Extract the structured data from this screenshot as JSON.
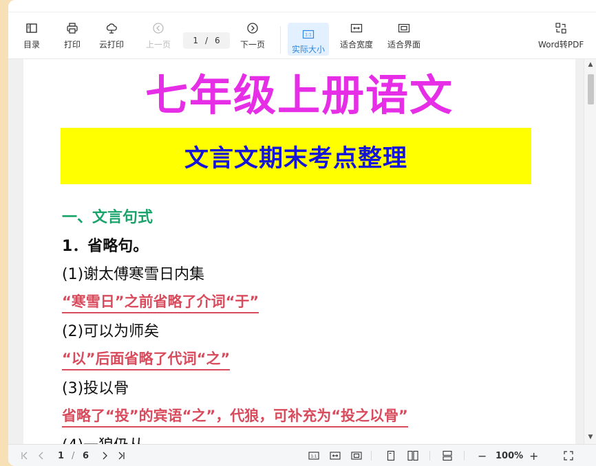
{
  "toolbar": {
    "toc": "目录",
    "print": "打印",
    "cloud_print": "云打印",
    "prev_page": "上一页",
    "current_page": "1",
    "page_sep": "/",
    "total_pages": "6",
    "next_page": "下一页",
    "actual_size": "实际大小",
    "fit_width": "适合宽度",
    "fit_page": "适合界面",
    "word_to_pdf": "Word转PDF",
    "actual_size_icon_text": "1:1"
  },
  "document": {
    "title": "七年级上册语文",
    "banner": "文言文期末考点整理",
    "section1": "一、文言句式",
    "sub1": "1．省略句。",
    "items": [
      {
        "q": "(1)谢太傅寒雪日内集",
        "a": "“寒雪日”之前省略了介词“于”"
      },
      {
        "q": "(2)可以为师矣",
        "a": "“以”后面省略了代词“之”"
      },
      {
        "q": "(3)投以骨",
        "a": "省略了“投”的宾语“之”，代狼，可补充为“投之以骨”"
      }
    ],
    "next_item_partial": "(4)一狼仍从"
  },
  "statusbar": {
    "current_page": "1",
    "page_sep": "/",
    "total_pages": "6",
    "zoom": "100%",
    "zoom_out": "−",
    "zoom_in": "+",
    "actual_size_icon_text": "1:1"
  },
  "colors": {
    "title": "#e62ee6",
    "banner_bg": "#ffff00",
    "banner_text": "#1515d6",
    "section": "#1aa36a",
    "answer": "#d84b5c",
    "active_tool": "#2e86de"
  },
  "icons": {
    "toc": "sidebar-icon",
    "print": "printer-icon",
    "cloud_print": "cloud-icon",
    "prev": "circle-left-icon",
    "next": "circle-right-icon",
    "actual_size": "actual-size-icon",
    "fit_width": "fit-width-icon",
    "fit_page": "fit-page-icon",
    "word_to_pdf": "convert-icon"
  }
}
